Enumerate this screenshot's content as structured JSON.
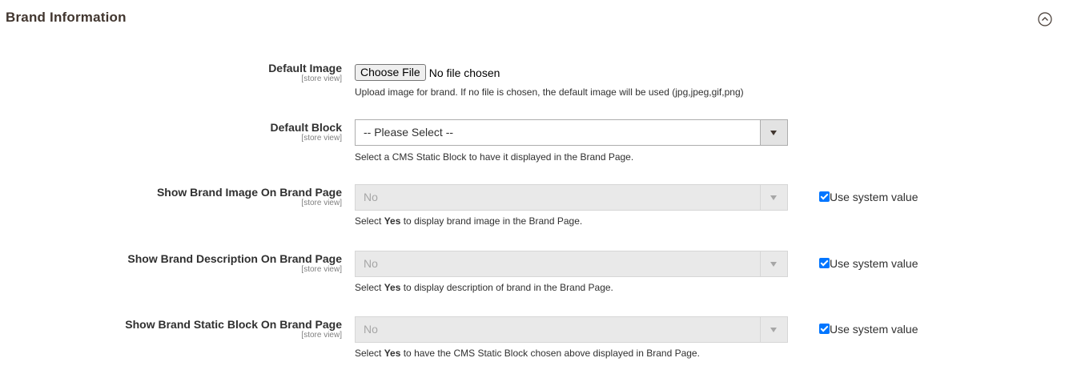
{
  "section": {
    "title": "Brand Information",
    "collapse_icon": "chevron-up-circle-icon"
  },
  "fields": {
    "default_image": {
      "label": "Default Image",
      "scope": "[store view]",
      "button_label": "Choose File",
      "file_status": "No file chosen",
      "note": "Upload image for brand. If no file is chosen, the default image will be used (jpg,jpeg,gif,png)"
    },
    "default_block": {
      "label": "Default Block",
      "scope": "[store view]",
      "value": "-- Please Select --",
      "note": "Select a CMS Static Block to have it displayed in the Brand Page."
    },
    "show_brand_image": {
      "label": "Show Brand Image On Brand Page",
      "scope": "[store view]",
      "value": "No",
      "disabled": true,
      "note_prefix": "Select ",
      "note_bold": "Yes",
      "note_suffix": " to display brand image in the Brand Page.",
      "use_system_label": "Use system value",
      "use_system_checked": true
    },
    "show_brand_description": {
      "label": "Show Brand Description On Brand Page",
      "scope": "[store view]",
      "value": "No",
      "disabled": true,
      "note_prefix": "Select ",
      "note_bold": "Yes",
      "note_suffix": " to display description of brand in the Brand Page.",
      "use_system_label": "Use system value",
      "use_system_checked": true
    },
    "show_brand_static_block": {
      "label": "Show Brand Static Block On Brand Page",
      "scope": "[store view]",
      "value": "No",
      "disabled": true,
      "note_prefix": "Select ",
      "note_bold": "Yes",
      "note_suffix": " to have the CMS Static Block chosen above displayed in Brand Page.",
      "use_system_label": "Use system value",
      "use_system_checked": true
    }
  },
  "colors": {
    "checkbox_accent": "#0075ff",
    "disabled_bg": "#e9e9e9",
    "title_text": "#41362f"
  }
}
